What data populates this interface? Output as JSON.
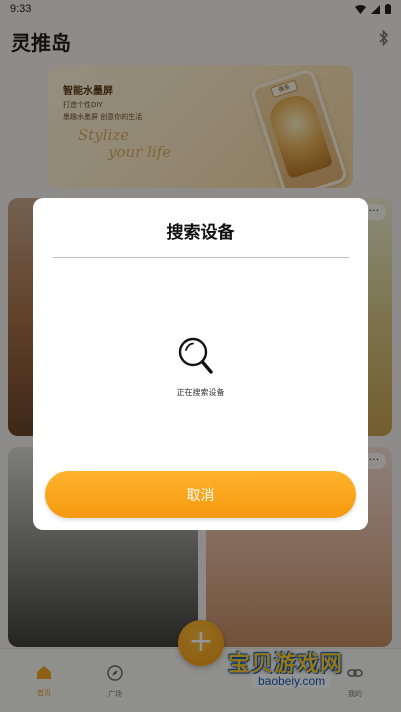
{
  "status_bar": {
    "time": "9:33"
  },
  "app": {
    "title": "灵推岛"
  },
  "banner": {
    "title": "智能水墨屏",
    "line1": "打造个性DIY",
    "line2": "墨趣水墨屏 创意你的生活",
    "script_line1": "Stylize",
    "script_line2": "your life",
    "frame_tag": "佛系"
  },
  "cards": {
    "more_label": "···"
  },
  "dialog": {
    "title": "搜索设备",
    "status": "正在搜索设备",
    "cancel_label": "取消"
  },
  "bottom_nav": {
    "home_label": "首页",
    "square_label": "广场",
    "mine_label": "我的",
    "fab_label": "+"
  },
  "watermark": {
    "text": "宝贝游戏网",
    "url": "baobeiy.com"
  },
  "colors": {
    "accent": "#f5a01a",
    "overlay": "rgba(0,0,0,0.42)"
  }
}
